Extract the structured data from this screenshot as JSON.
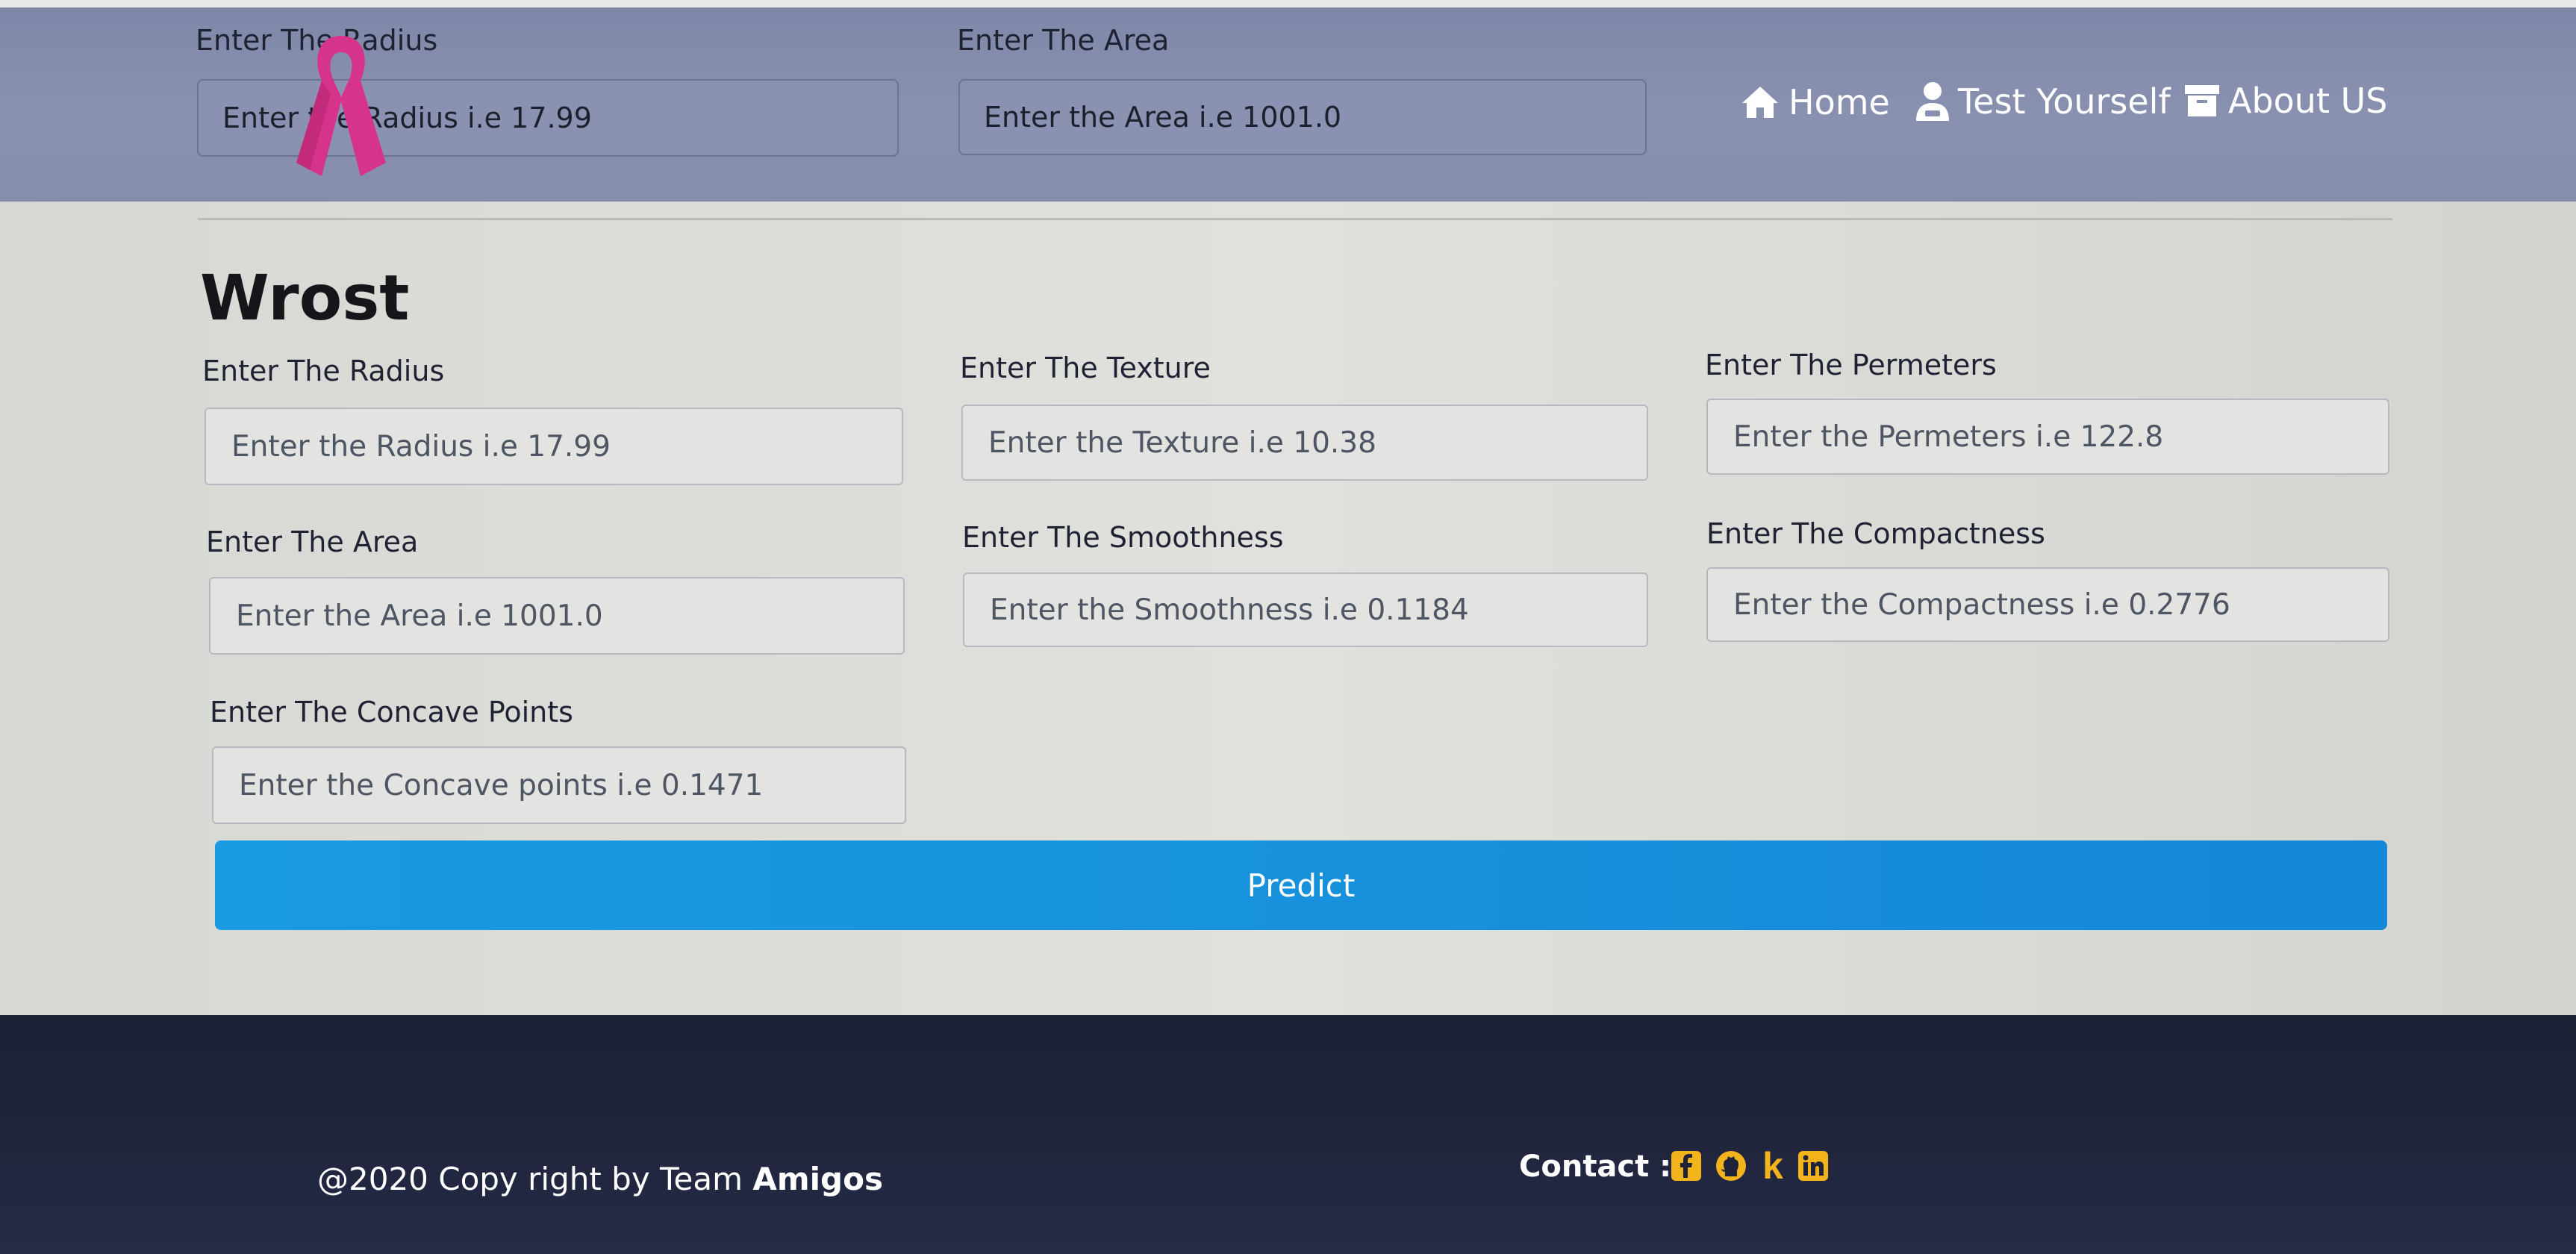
{
  "header": {
    "fields": [
      {
        "label": "Enter The Radius",
        "placeholder": "Enter the Radius i.e 17.99"
      },
      {
        "label": "Enter The Area",
        "placeholder": "Enter the Area i.e 1001.0"
      }
    ],
    "nav": [
      {
        "label": "Home",
        "icon": "home-icon"
      },
      {
        "label": "Test Yourself",
        "icon": "user-icon"
      },
      {
        "label": "About US",
        "icon": "archive-icon"
      }
    ]
  },
  "section": {
    "title": "Wrost",
    "fields": [
      {
        "label": "Enter The Radius",
        "placeholder": "Enter the Radius i.e 17.99"
      },
      {
        "label": "Enter The Texture",
        "placeholder": "Enter the Texture i.e 10.38"
      },
      {
        "label": "Enter The Permeters",
        "placeholder": "Enter the Permeters i.e 122.8"
      },
      {
        "label": "Enter The Area",
        "placeholder": "Enter the Area i.e 1001.0"
      },
      {
        "label": "Enter The Smoothness",
        "placeholder": "Enter the Smoothness i.e 0.1184"
      },
      {
        "label": "Enter The Compactness",
        "placeholder": "Enter the Compactness i.e 0.2776"
      },
      {
        "label": "Enter The Concave Points",
        "placeholder": "Enter the Concave points i.e 0.1471"
      }
    ],
    "predict_label": "Predict"
  },
  "footer": {
    "copyright_prefix": "@2020 Copy right by Team ",
    "copyright_team": "Amigos",
    "contact_label": "Contact :",
    "social": [
      "facebook-icon",
      "github-icon",
      "kaggle-icon",
      "linkedin-icon"
    ]
  },
  "colors": {
    "navbar": "#8a91b0",
    "predict_button": "#1592dc",
    "footer": "#1f2339",
    "social_icons": "#f3b41b",
    "ribbon": "#d6338a"
  }
}
